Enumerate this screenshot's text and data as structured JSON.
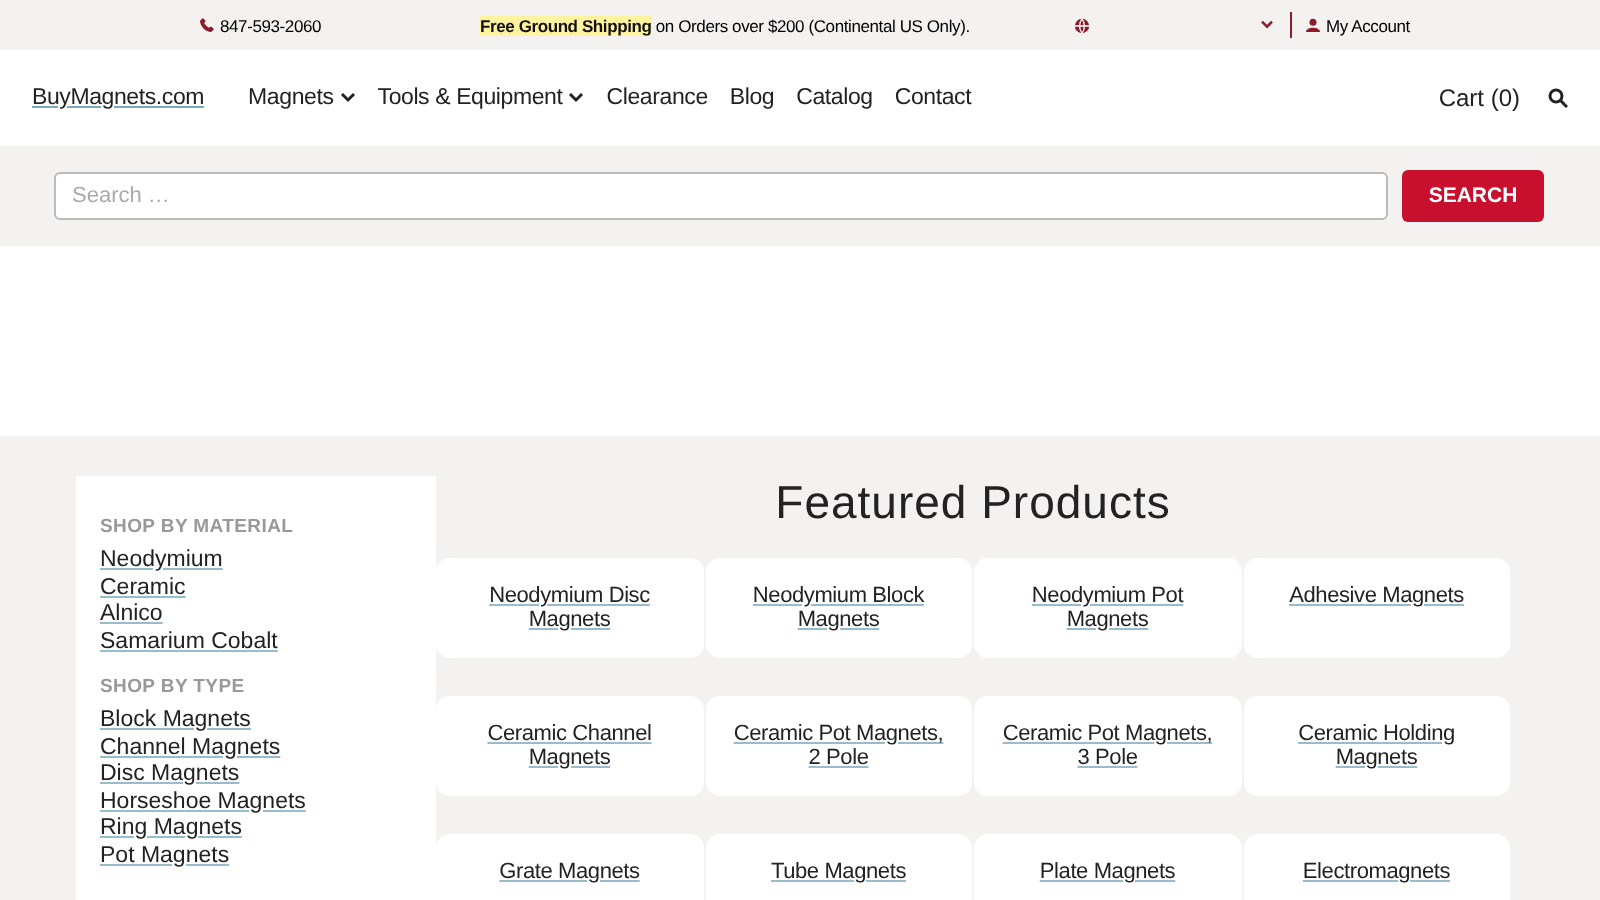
{
  "top_bar": {
    "phone": "847-593-2060",
    "shipping_highlight": "Free Ground Shipping",
    "shipping_rest": "on Orders over $200 (Continental US Only).",
    "account": "My Account"
  },
  "nav": {
    "logo": "BuyMagnets.com",
    "items": [
      {
        "label": "Magnets",
        "has_dropdown": true
      },
      {
        "label": "Tools & Equipment",
        "has_dropdown": true
      },
      {
        "label": "Clearance",
        "has_dropdown": false
      },
      {
        "label": "Blog",
        "has_dropdown": false
      },
      {
        "label": "Catalog",
        "has_dropdown": false
      },
      {
        "label": "Contact",
        "has_dropdown": false
      }
    ],
    "cart": "Cart (0)"
  },
  "search": {
    "placeholder": "Search …",
    "button": "SEARCH"
  },
  "sidebar": {
    "sections": [
      {
        "heading": "SHOP BY MATERIAL",
        "links": [
          "Neodymium",
          "Ceramic",
          "Alnico",
          "Samarium Cobalt"
        ]
      },
      {
        "heading": "SHOP BY TYPE",
        "links": [
          "Block Magnets",
          "Channel Magnets",
          "Disc Magnets",
          "Horseshoe Magnets",
          "Ring Magnets",
          "Pot Magnets"
        ]
      }
    ]
  },
  "featured": {
    "title": "Featured Products",
    "products": [
      "Neodymium Disc Magnets",
      "Neodymium Block Magnets",
      "Neodymium Pot Magnets",
      "Adhesive Magnets",
      "Ceramic Channel Magnets",
      "Ceramic Pot Magnets, 2 Pole",
      "Ceramic Pot Magnets, 3 Pole",
      "Ceramic Holding Magnets",
      "Grate Magnets",
      "Tube Magnets",
      "Plate Magnets",
      "Electromagnets"
    ]
  }
}
